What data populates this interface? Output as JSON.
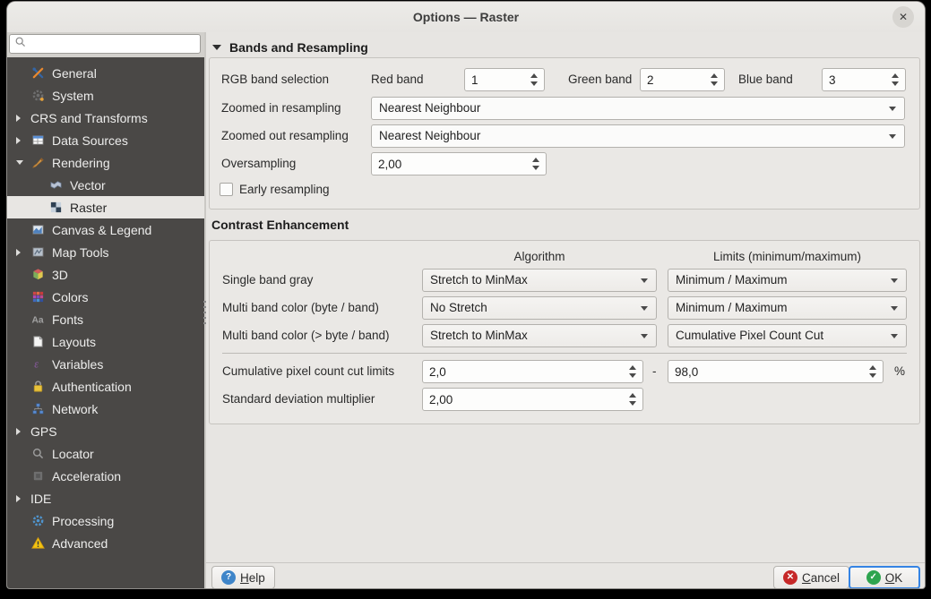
{
  "window": {
    "title": "Options — Raster",
    "close_glyph": "✕"
  },
  "sidebar": {
    "search_placeholder": "",
    "items": [
      {
        "label": "General",
        "icon": "general-icon",
        "arrow": null,
        "level": 1,
        "selected": false
      },
      {
        "label": "System",
        "icon": "system-icon",
        "arrow": null,
        "level": 1,
        "selected": false
      },
      {
        "label": "CRS and Transforms",
        "icon": null,
        "arrow": "collapsed",
        "level": 0,
        "selected": false
      },
      {
        "label": "Data Sources",
        "icon": "data-sources-icon",
        "arrow": "collapsed",
        "level": 0,
        "selected": false
      },
      {
        "label": "Rendering",
        "icon": "rendering-icon",
        "arrow": "expanded",
        "level": 0,
        "selected": false
      },
      {
        "label": "Vector",
        "icon": "vector-icon",
        "arrow": null,
        "level": 2,
        "selected": false
      },
      {
        "label": "Raster",
        "icon": "raster-icon",
        "arrow": null,
        "level": 2,
        "selected": true
      },
      {
        "label": "Canvas & Legend",
        "icon": "canvas-legend-icon",
        "arrow": null,
        "level": 1,
        "selected": false
      },
      {
        "label": "Map Tools",
        "icon": "map-tools-icon",
        "arrow": "collapsed",
        "level": 0,
        "selected": false
      },
      {
        "label": "3D",
        "icon": "3d-icon",
        "arrow": null,
        "level": 1,
        "selected": false
      },
      {
        "label": "Colors",
        "icon": "colors-icon",
        "arrow": null,
        "level": 1,
        "selected": false
      },
      {
        "label": "Fonts",
        "icon": "fonts-icon",
        "arrow": null,
        "level": 1,
        "selected": false
      },
      {
        "label": "Layouts",
        "icon": "layouts-icon",
        "arrow": null,
        "level": 1,
        "selected": false
      },
      {
        "label": "Variables",
        "icon": "variables-icon",
        "arrow": null,
        "level": 1,
        "selected": false
      },
      {
        "label": "Authentication",
        "icon": "authentication-icon",
        "arrow": null,
        "level": 1,
        "selected": false
      },
      {
        "label": "Network",
        "icon": "network-icon",
        "arrow": null,
        "level": 1,
        "selected": false
      },
      {
        "label": "GPS",
        "icon": null,
        "arrow": "collapsed",
        "level": 0,
        "selected": false
      },
      {
        "label": "Locator",
        "icon": "locator-icon",
        "arrow": null,
        "level": 1,
        "selected": false
      },
      {
        "label": "Acceleration",
        "icon": "acceleration-icon",
        "arrow": null,
        "level": 1,
        "selected": false
      },
      {
        "label": "IDE",
        "icon": null,
        "arrow": "collapsed",
        "level": 0,
        "selected": false
      },
      {
        "label": "Processing",
        "icon": "processing-icon",
        "arrow": null,
        "level": 1,
        "selected": false
      },
      {
        "label": "Advanced",
        "icon": "advanced-icon",
        "arrow": null,
        "level": 1,
        "selected": false
      }
    ]
  },
  "panel": {
    "bands": {
      "title": "Bands and Resampling",
      "rgb_label": "RGB band selection",
      "red_label": "Red band",
      "red_value": "1",
      "green_label": "Green band",
      "green_value": "2",
      "blue_label": "Blue band",
      "blue_value": "3",
      "zoomed_in_label": "Zoomed in resampling",
      "zoomed_in_value": "Nearest Neighbour",
      "zoomed_out_label": "Zoomed out resampling",
      "zoomed_out_value": "Nearest Neighbour",
      "oversampling_label": "Oversampling",
      "oversampling_value": "2,00",
      "early_resampling_label": "Early resampling",
      "early_resampling_checked": false
    },
    "contrast": {
      "title": "Contrast Enhancement",
      "col_algorithm": "Algorithm",
      "col_limits": "Limits (minimum/maximum)",
      "rows": [
        {
          "label": "Single band gray",
          "algorithm": "Stretch to MinMax",
          "limits": "Minimum / Maximum"
        },
        {
          "label": "Multi band color (byte / band)",
          "algorithm": "No Stretch",
          "limits": "Minimum / Maximum"
        },
        {
          "label": "Multi band color (> byte / band)",
          "algorithm": "Stretch to MinMax",
          "limits": "Cumulative Pixel Count Cut"
        }
      ],
      "cumulative_label": "Cumulative pixel count cut limits",
      "cumulative_min": "2,0",
      "dash": "-",
      "cumulative_max": "98,0",
      "percent": "%",
      "stddev_label": "Standard deviation multiplier",
      "stddev_value": "2,00"
    }
  },
  "footer": {
    "help_label": "Help",
    "cancel_label": "Cancel",
    "ok_label": "OK"
  },
  "colors": {
    "ok_green": "#2ea44f",
    "cancel_red": "#c62828",
    "help_blue": "#3f85c9",
    "ok_focus_border": "#3584e4",
    "sidebar_bg": "#4a4846",
    "selection_bg": "#e8e6e3"
  }
}
